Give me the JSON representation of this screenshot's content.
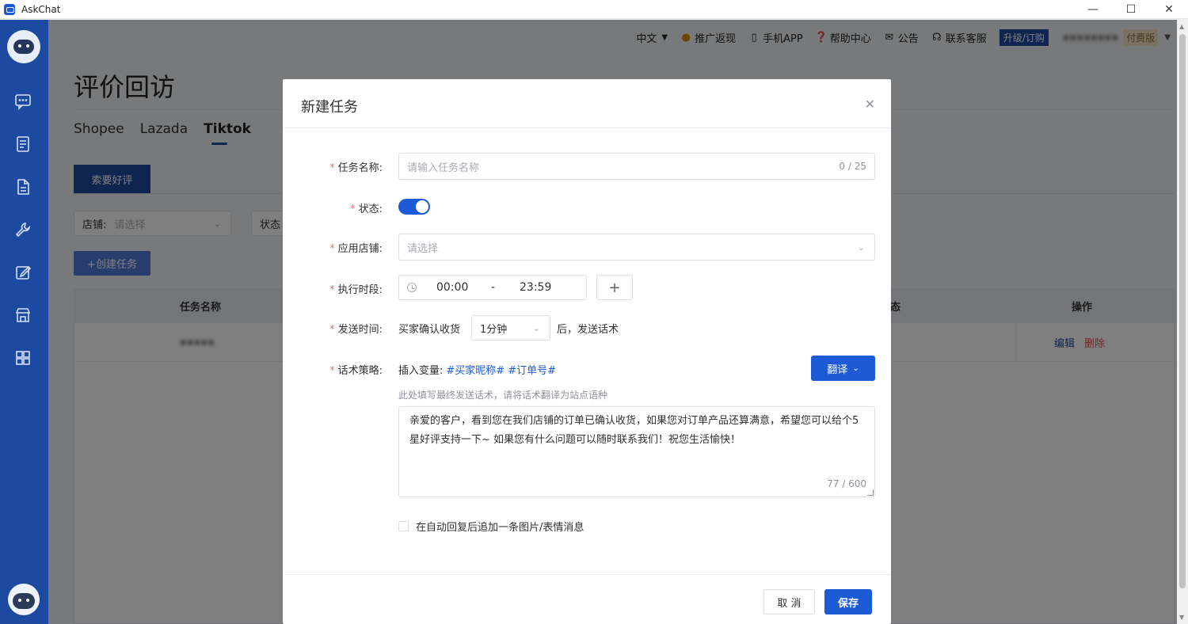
{
  "window": {
    "title": "AskChat",
    "minimize": "—",
    "maximize": "☐",
    "close": "✕"
  },
  "topnav": {
    "language": "中文",
    "promo": "推广返现",
    "mobile_app": "手机APP",
    "help": "帮助中心",
    "notice": "公告",
    "support": "联系客服",
    "upgrade": "升级/订购",
    "plan_badge": "付费版"
  },
  "page": {
    "title": "评价回访",
    "tabs": [
      "Shopee",
      "Lazada",
      "Tiktok"
    ],
    "active_tab": "Tiktok",
    "subtab": "索要好评",
    "filter_shop_label": "店铺:",
    "filter_shop_placeholder": "请选择",
    "filter_status_label": "状态",
    "create_button": "+创建任务",
    "table": {
      "col_name": "任务名称",
      "col_status": "态",
      "col_ops": "操作",
      "rows": [
        {
          "name": "▪▪▪▪▪",
          "edit": "编辑",
          "delete": "删除"
        }
      ]
    }
  },
  "modal": {
    "title": "新建任务",
    "task_name_label": "任务名称:",
    "task_name_placeholder": "请输入任务名称",
    "task_name_counter": "0 / 25",
    "status_label": "状态:",
    "status_on": true,
    "shop_label": "应用店铺:",
    "shop_placeholder": "请选择",
    "period_label": "执行时段:",
    "period_start": "00:00",
    "period_sep": "-",
    "period_end": "23:59",
    "add_period": "+",
    "send_time_label": "发送时间:",
    "send_time_pre": "买家确认收货",
    "send_time_value": "1分钟",
    "send_time_post": "后，发送话术",
    "strategy_label": "话术策略:",
    "insert_vars_label": "插入变量:",
    "var_nickname": "#买家昵称#",
    "var_order": "#订单号#",
    "translate_button": "翻译",
    "hint": "此处填写最终发送话术，请将话术翻译为站点语种",
    "message": "亲爱的客户，看到您在我们店铺的订单已确认收货，如果您对订单产品还算满意，希望您可以给个5星好评支持一下~ 如果您有什么问题可以随时联系我们！祝您生活愉快！",
    "message_counter": "77 / 600",
    "append_image_label": "在自动回复后追加一条图片/表情消息",
    "cancel_button": "取 消",
    "save_button": "保存"
  },
  "colors": {
    "primary": "#1d5bd6",
    "sidebar": "#1d4aa1",
    "required": "#f56c6c",
    "danger": "#e05050"
  }
}
